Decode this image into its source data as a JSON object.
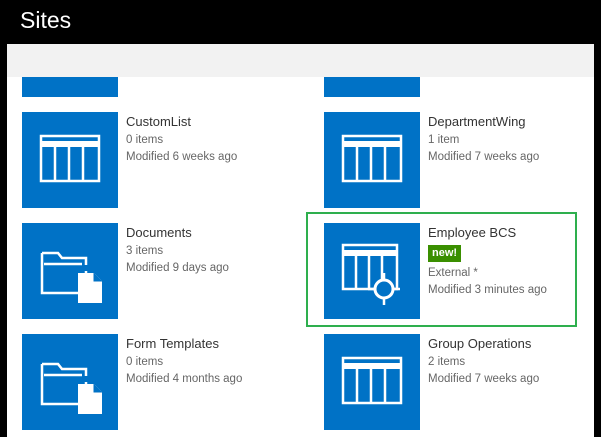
{
  "header": {
    "title": "Sites"
  },
  "tiles": [
    {
      "title": "CustomList",
      "line1": "0 items",
      "line2": "Modified 6 weeks ago"
    },
    {
      "title": "DepartmentWing",
      "line1": "1 item",
      "line2": "Modified 7 weeks ago"
    },
    {
      "title": "Documents",
      "line1": "3 items",
      "line2": "Modified 9 days ago"
    },
    {
      "title": "Employee BCS",
      "badge": "new!",
      "line1": "External *",
      "line2": "Modified 3 minutes ago"
    },
    {
      "title": "Form Templates",
      "line1": "0 items",
      "line2": "Modified 4 months ago"
    },
    {
      "title": "Group Operations",
      "line1": "2 items",
      "line2": "Modified 7 weeks ago"
    }
  ],
  "colors": {
    "tile": "#0072c6",
    "badge": "#3a8f00",
    "highlight": "#2eaf4e",
    "header_bg": "#000000"
  }
}
